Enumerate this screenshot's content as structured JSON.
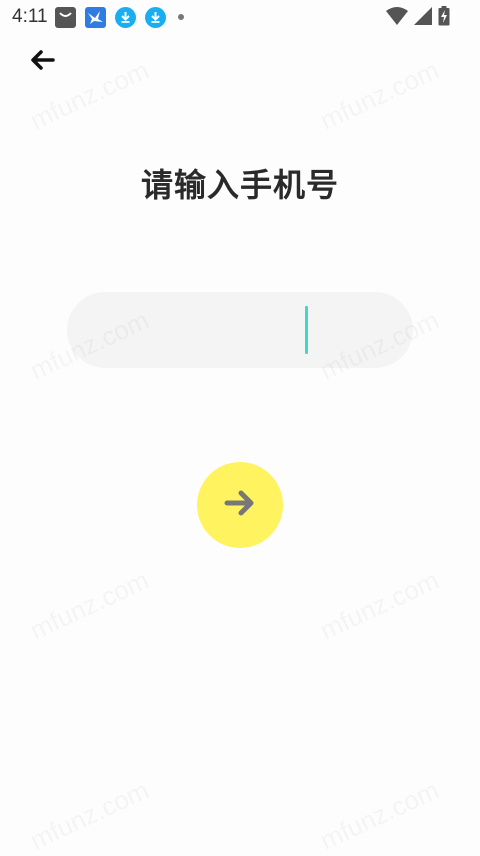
{
  "status_bar": {
    "time": "4:11",
    "notification_icons": [
      "bag-icon",
      "bird-app-icon",
      "download-icon",
      "download-icon",
      "dot-icon"
    ],
    "system_icons": [
      "wifi-icon",
      "cellular-signal-icon",
      "battery-charging-icon"
    ]
  },
  "header": {
    "back_icon": "arrow-left-icon"
  },
  "main": {
    "title": "请输入手机号",
    "phone_input": {
      "value": "",
      "placeholder": ""
    },
    "next_button_icon": "arrow-right-icon"
  },
  "watermark": {
    "text": "mfunz.com"
  },
  "colors": {
    "background": "#fdfdfd",
    "input_bg": "#f4f4f4",
    "caret": "#3fd9c9",
    "next_button": "#fff45f",
    "next_arrow": "#777777",
    "title": "#2a2a2a"
  }
}
